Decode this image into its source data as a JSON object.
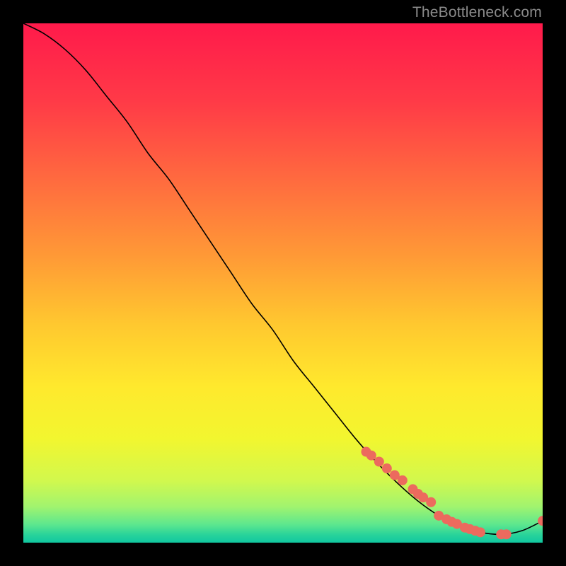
{
  "watermark": "TheBottleneck.com",
  "chart_data": {
    "type": "line",
    "title": "",
    "xlabel": "",
    "ylabel": "",
    "xlim": [
      0,
      100
    ],
    "ylim": [
      0,
      100
    ],
    "grid": false,
    "series": [
      {
        "name": "curve",
        "color": "#000000",
        "x": [
          0,
          4,
          8,
          12,
          16,
          20,
          24,
          28,
          32,
          36,
          40,
          44,
          48,
          52,
          56,
          60,
          64,
          68,
          72,
          76,
          80,
          84,
          88,
          92,
          96,
          100
        ],
        "y": [
          100,
          98,
          95,
          91,
          86,
          81,
          75,
          70,
          64,
          58,
          52,
          46,
          41,
          35,
          30,
          25,
          20,
          15.5,
          11.5,
          8.0,
          5.2,
          3.2,
          2.0,
          1.6,
          2.3,
          4.2
        ]
      }
    ],
    "markers": {
      "name": "dots",
      "color": "#ec6a5e",
      "radius_px": 7,
      "x": [
        66,
        67,
        68.5,
        70,
        71.5,
        73,
        75,
        76,
        77,
        78.5,
        80,
        81.5,
        82.5,
        83.5,
        85,
        86,
        87,
        88,
        92,
        93,
        100
      ],
      "y": [
        17.5,
        16.8,
        15.6,
        14.3,
        13.0,
        12.0,
        10.3,
        9.4,
        8.7,
        7.8,
        5.2,
        4.5,
        4.0,
        3.6,
        2.9,
        2.6,
        2.3,
        2.0,
        1.6,
        1.6,
        4.2
      ]
    },
    "background_gradient": {
      "type": "vertical",
      "stops": [
        {
          "pos": 0.0,
          "color": "#ff1a4b"
        },
        {
          "pos": 0.15,
          "color": "#ff3a47"
        },
        {
          "pos": 0.3,
          "color": "#ff6a3f"
        },
        {
          "pos": 0.45,
          "color": "#ff9a36"
        },
        {
          "pos": 0.58,
          "color": "#ffc82f"
        },
        {
          "pos": 0.7,
          "color": "#ffe92d"
        },
        {
          "pos": 0.8,
          "color": "#f2f62f"
        },
        {
          "pos": 0.88,
          "color": "#d2f84d"
        },
        {
          "pos": 0.93,
          "color": "#a2f46e"
        },
        {
          "pos": 0.965,
          "color": "#5de78e"
        },
        {
          "pos": 0.985,
          "color": "#28d39a"
        },
        {
          "pos": 1.0,
          "color": "#11c7a0"
        }
      ]
    }
  }
}
